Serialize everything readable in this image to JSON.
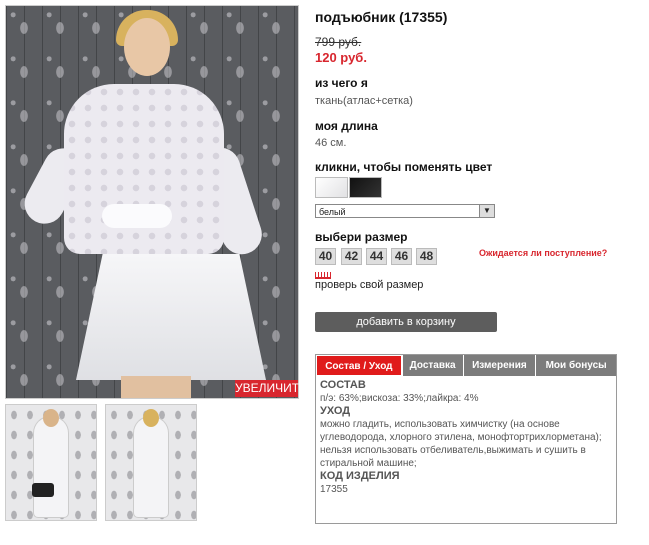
{
  "product": {
    "title": "подъюбник (17355)",
    "old_price": "799 руб.",
    "new_price": "120 руб.",
    "material_label": "из чего я",
    "material_value": "ткань(атлас+сетка)",
    "length_label": "моя длина",
    "length_value": "46 см.",
    "color_label": "кликни, чтобы поменять цвет",
    "colors": [
      {
        "name": "white",
        "hex": "#ffffff"
      },
      {
        "name": "black",
        "hex": "#111111"
      }
    ],
    "color_select_value": "белый",
    "size_label": "выбери размер",
    "sizes": [
      "40",
      "42",
      "44",
      "46",
      "48"
    ],
    "notify_link": "Ожидается ли поступление?",
    "size_check_link": "проверь свой размер",
    "cart_button": "добавить в корзину",
    "zoom_button": "УВЕЛИЧИТЬ"
  },
  "tabs": [
    {
      "label": "Состав / Уход",
      "active": true
    },
    {
      "label": "Доставка",
      "active": false
    },
    {
      "label": "Измерения",
      "active": false
    },
    {
      "label": "Мои бонусы",
      "active": false
    }
  ],
  "tab_content": {
    "composition_heading": "СОСТАВ",
    "composition_text": "п/э: 63%;вискоза: 33%;лайкра: 4%",
    "care_heading": "УХОД",
    "care_text": "можно гладить, использовать химчистку (на основе углеводорода, хлорного этилена, монофтортрихлорметана); нельзя использовать отбеливатель,выжимать и сушить в стиральной машине;",
    "code_heading": "КОД ИЗДЕЛИЯ",
    "code_value": "17355"
  },
  "colors": {
    "accent_red": "#d8262e",
    "tab_active": "#e01b1b",
    "tab_inactive": "#7c7c7c",
    "button_dark": "#5d5d5d"
  }
}
